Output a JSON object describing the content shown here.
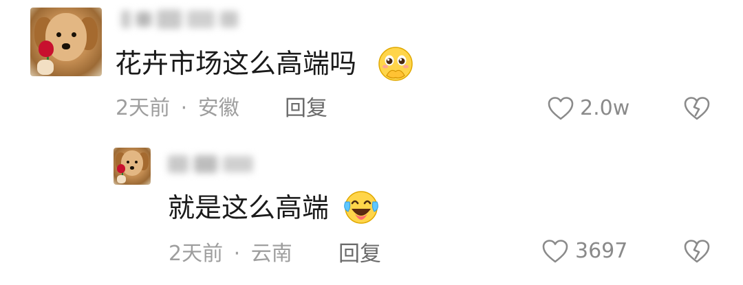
{
  "comments": [
    {
      "author_name": "",
      "text": "花卉市场这么高端吗",
      "emoji_icon": "pleading-face-hands-over-mouth-icon",
      "time": "2天前",
      "separator": "·",
      "location": "安徽",
      "reply_label": "回复",
      "likes": "2.0w",
      "like_icon": "heart-outline-icon",
      "dislike_icon": "broken-heart-icon"
    },
    {
      "author_name": "",
      "text": "就是这么高端",
      "emoji_icon": "tears-of-joy-face-icon",
      "time": "2天前",
      "separator": "·",
      "location": "云南",
      "reply_label": "回复",
      "likes": "3697",
      "like_icon": "heart-outline-icon",
      "dislike_icon": "broken-heart-icon"
    }
  ],
  "colors": {
    "text": "#1a1a1a",
    "meta": "#9e9e9e",
    "icon": "#8a8a8a",
    "background": "#ffffff"
  }
}
